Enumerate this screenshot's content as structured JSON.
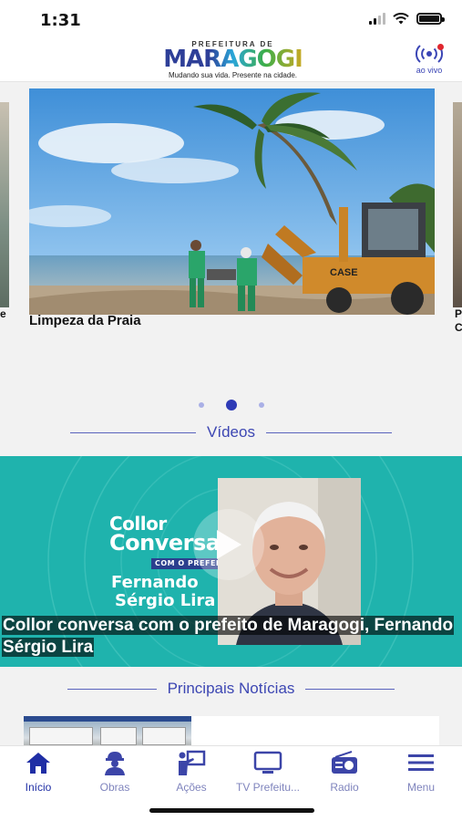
{
  "status": {
    "time": "1:31"
  },
  "header": {
    "logo_top": "PREFEITURA DE",
    "logo_main": "MARAGOGI",
    "logo_sub": "Mudando sua vida. Presente na cidade.",
    "live_label": "ao vivo",
    "live_icon": "broadcast-icon"
  },
  "carousel": {
    "left_peek_caption": "e",
    "current_caption": "Limpeza da Praia",
    "right_peek_caption": "P C",
    "slides_count": 3,
    "active_index": 1
  },
  "videos": {
    "section_title": "Vídeos",
    "brand_line1": "Collor",
    "brand_line2": "Conversa",
    "brand_tag": "COM O PREFEITO",
    "brand_name1": "Fernando",
    "brand_name2": "Sérgio Lira",
    "caption": "Collor conversa com o prefeito de Maragogi, Fernando Sérgio Lira"
  },
  "news": {
    "section_title": "Principais Notícias"
  },
  "tabs": [
    {
      "label": "Início",
      "icon": "home-icon",
      "active": true
    },
    {
      "label": "Obras",
      "icon": "worker-icon",
      "active": false
    },
    {
      "label": "Ações",
      "icon": "presentation-icon",
      "active": false
    },
    {
      "label": "TV Prefeitu...",
      "icon": "tv-icon",
      "active": false
    },
    {
      "label": "Radio",
      "icon": "radio-icon",
      "active": false
    },
    {
      "label": "Menu",
      "icon": "menu-icon",
      "active": false
    }
  ],
  "colors": {
    "accent": "#2e3bb6",
    "teal": "#1fb3ad",
    "live_dot": "#e0262e"
  }
}
